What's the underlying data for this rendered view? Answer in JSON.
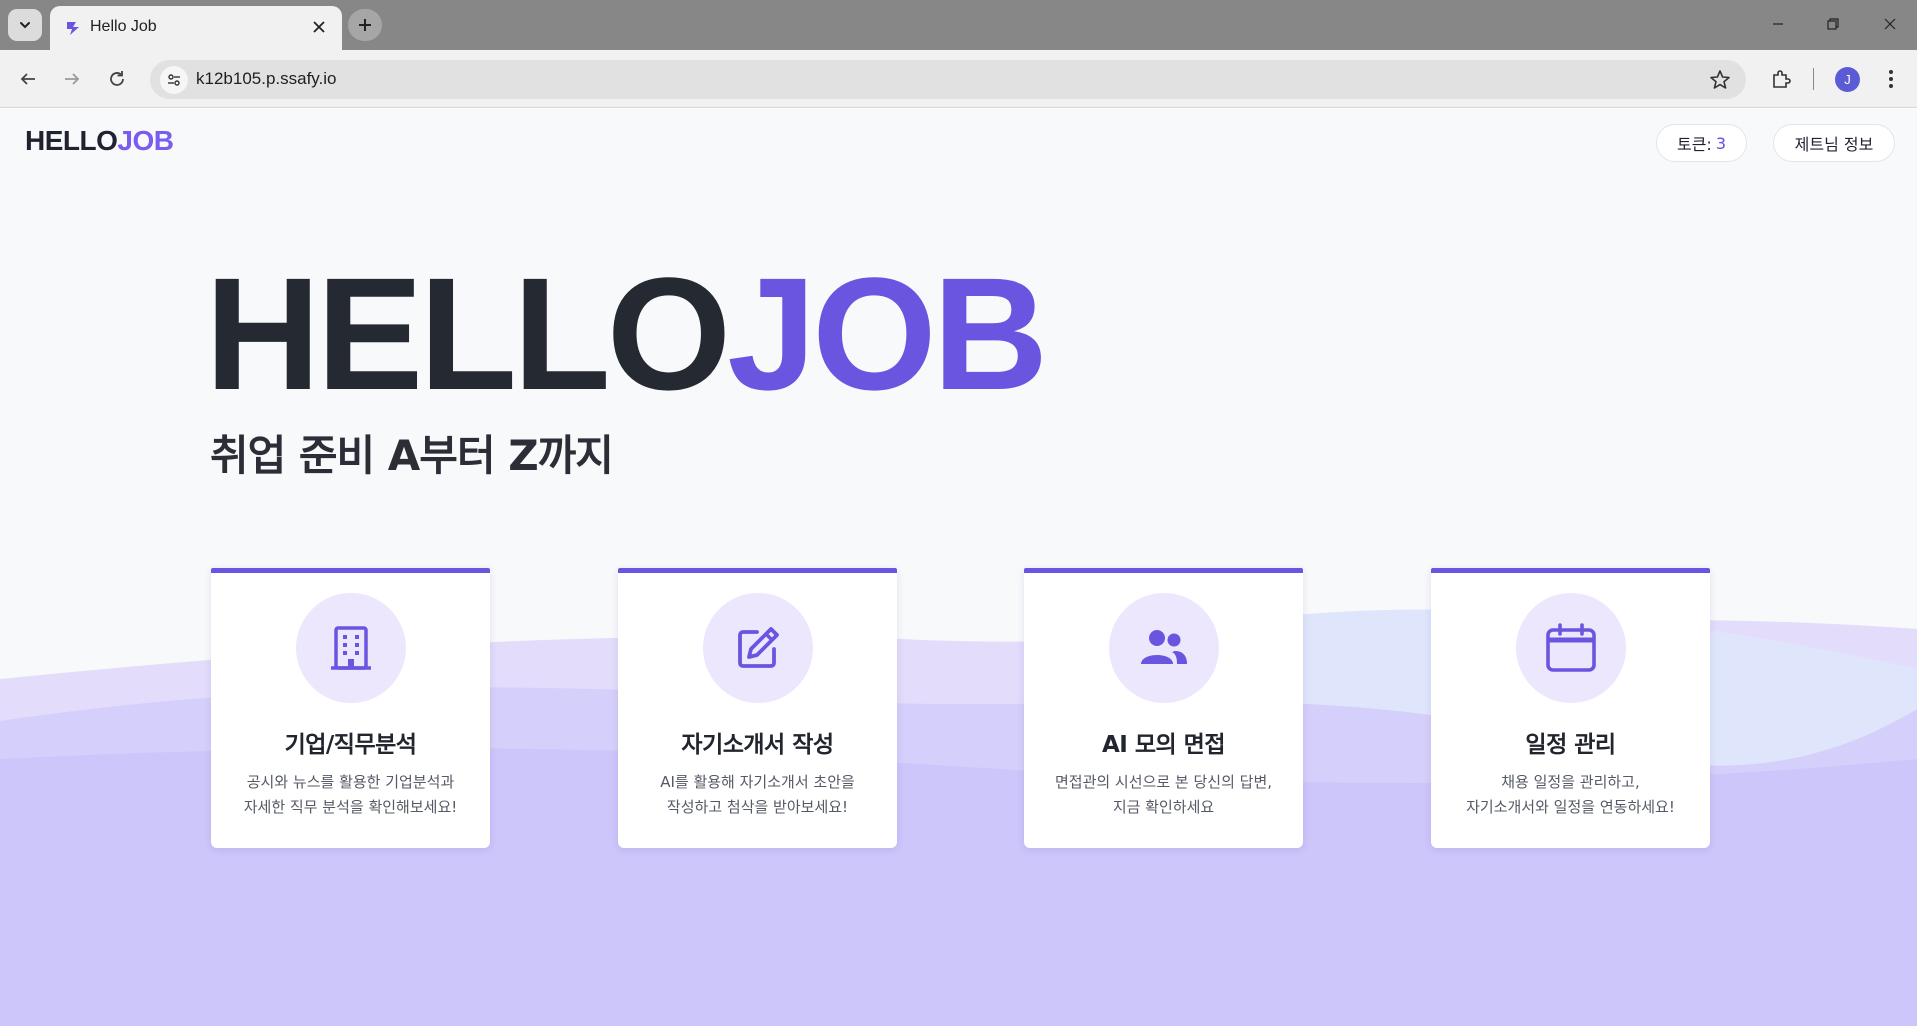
{
  "browser": {
    "tab_title": "Hello Job",
    "url": "k12b105.p.ssafy.io",
    "profile_initial": "J"
  },
  "header": {
    "logo_hello": "HELLO",
    "logo_job": "JOB",
    "token_label": "토큰:",
    "token_count": "3",
    "user_button": "제트님 정보"
  },
  "hero": {
    "title_hello": "HELLO",
    "title_job": "JOB",
    "subtitle": "취업 준비 A부터 Z까지"
  },
  "cards": [
    {
      "icon": "building-icon",
      "title": "기업/직무분석",
      "desc_line1": "공시와 뉴스를 활용한 기업분석과",
      "desc_line2": "자세한 직무 분석을 확인해보세요!"
    },
    {
      "icon": "edit-icon",
      "title": "자기소개서 작성",
      "desc_line1": "AI를 활용해 자기소개서 초안을",
      "desc_line2": "작성하고 첨삭을 받아보세요!"
    },
    {
      "icon": "users-icon",
      "title": "AI 모의 면접",
      "desc_line1": "면접관의 시선으로 본 당신의 답변,",
      "desc_line2": "지금 확인하세요"
    },
    {
      "icon": "calendar-icon",
      "title": "일정 관리",
      "desc_line1": "채용 일정을 관리하고,",
      "desc_line2": "자기소개서와 일정을 연동하세요!"
    }
  ],
  "colors": {
    "accent": "#6a55e0",
    "logo_dark": "#252932",
    "wave_main": "#cdc6fb",
    "icon_bg": "#ece7fd"
  }
}
